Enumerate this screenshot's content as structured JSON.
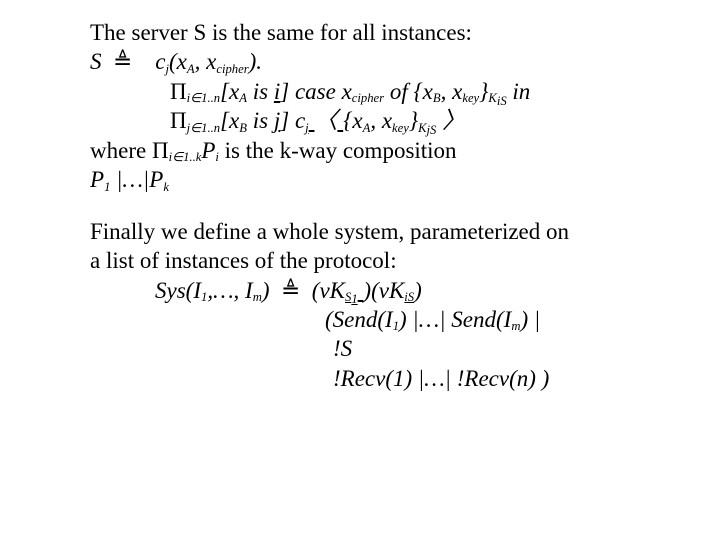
{
  "p1": {
    "intro": "The server S is the same for all instances:",
    "sdef_lhs": "S",
    "tri": "≜",
    "cj": "c",
    "cj_sub": "j",
    "lp": "(x",
    "xA": "A",
    "comma_x": ", x",
    "cipher": "cipher",
    "rp_dot": ").",
    "pi": "Π",
    "i_in_1n": "i∈1..n",
    "lbr_xA": "[x",
    "is": " is ",
    "i_u": "i",
    "close_case_x": "] case x",
    "of_lb": " of {x",
    "B": "B",
    "key": "key",
    "rb": "}",
    "K": "K",
    "iS": "iS",
    "in": " in",
    "j_in_1n": "j∈1..n",
    "j_u": "j",
    "cj2": "] c",
    "angL": "〈",
    "open_set_x": "{x",
    "jS": "jS",
    "angR": "〉",
    "where": "where ",
    "i_in_1k": "i∈1..k",
    "P": "P",
    "i": "i",
    "kway": " is the k-way composition",
    "P1": "P",
    "one": "1",
    "bars_dots": " |…|",
    "Pk": "P",
    "k": "k"
  },
  "p2": {
    "intro1": "Finally we define a whole system, parameterized on",
    "intro2": "a list of instances of the protocol:",
    "Sys": "Sys(I",
    "one": "1",
    "comma_dots": ",…,",
    "I": "I",
    "m": "m",
    "rp": ")",
    "tri": "≜",
    "nuK_open": "(νK",
    "s1": "S",
    "one_sub": "1",
    "rp2": ")",
    "is": "iS",
    "Send_open": "(Send(I",
    "rp_bar_dots_bar": ") |…| ",
    "Send2": "Send(I",
    "close_pipe": ") |",
    "bangS": "!S",
    "Recv_open": "!Recv(",
    "n": "n",
    "close_close": ") )"
  }
}
